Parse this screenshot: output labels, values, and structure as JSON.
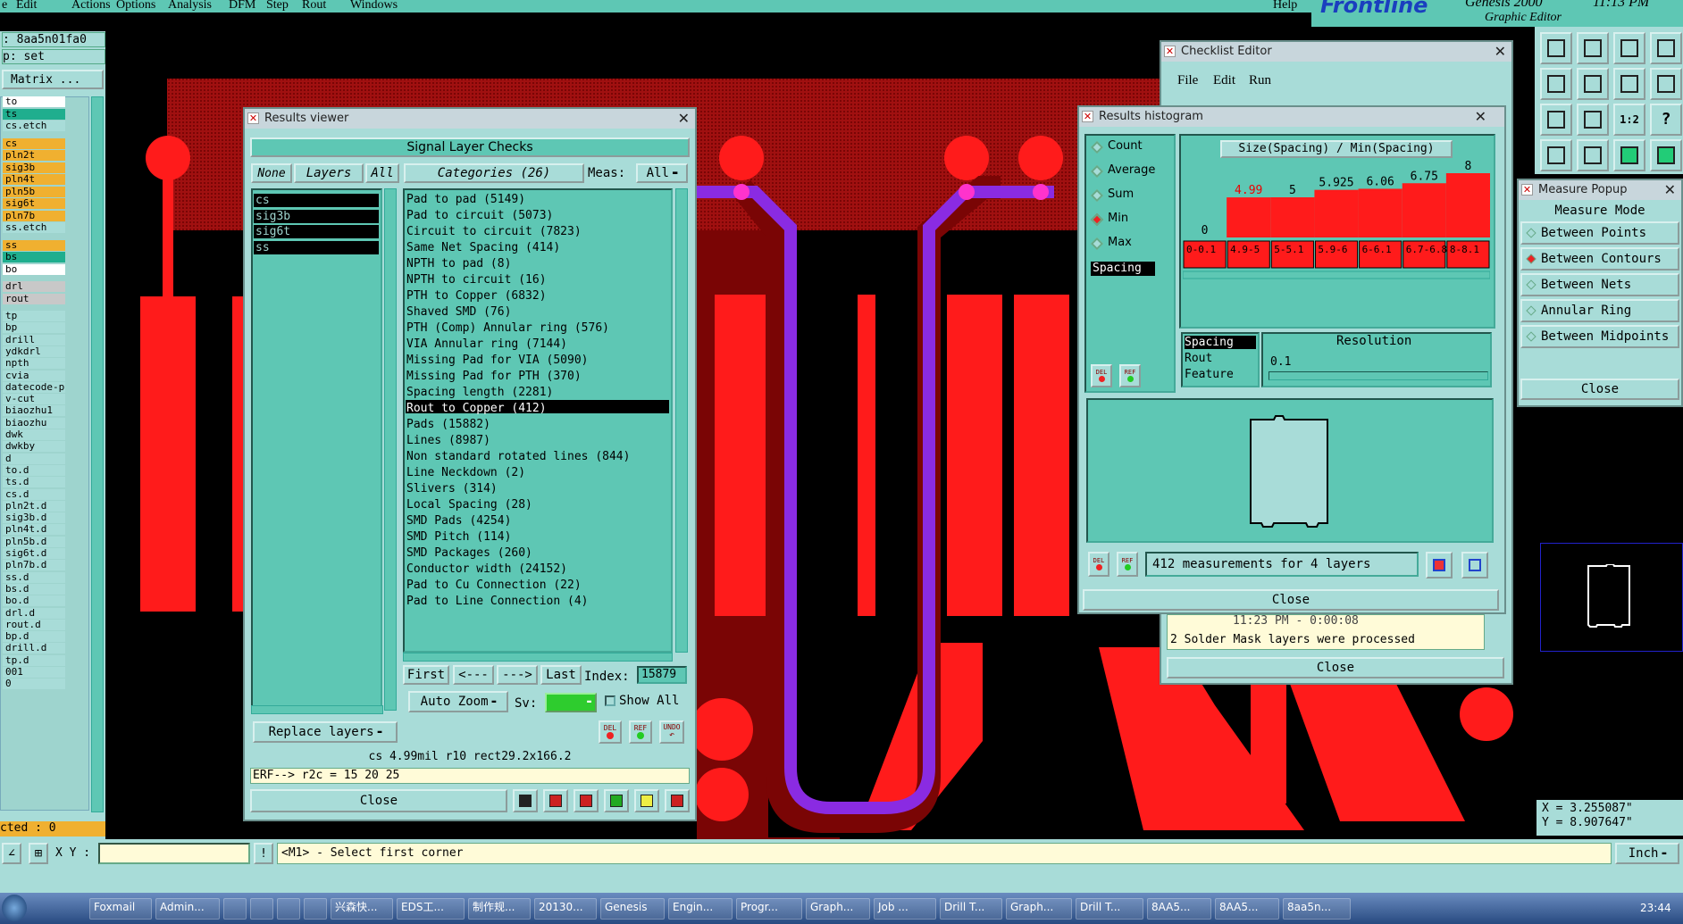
{
  "menubar": {
    "items": [
      "e",
      "Edit",
      "Actions",
      "Options",
      "Analysis",
      "DFM",
      "Step",
      "Rout",
      "Windows"
    ],
    "help": "Help",
    "brand": "Frontline",
    "product": "Genesis 2000",
    "subtitle": "Graphic Editor",
    "clock": "11:13 PM"
  },
  "left_panel": {
    "job": ": 8aa5n01fa0",
    "step": "p: set",
    "matrix_btn": "Matrix ...",
    "selected": "cted : 0"
  },
  "layers": [
    {
      "name": "to",
      "color": "#ffffff"
    },
    {
      "name": "ts",
      "color": "#1fae8e"
    },
    {
      "name": "cs.etch",
      "color": "#a8dcd8"
    },
    {
      "name": "cs",
      "color": "#f0b030"
    },
    {
      "name": "pln2t",
      "color": "#f0b030"
    },
    {
      "name": "sig3b",
      "color": "#f0b030"
    },
    {
      "name": "pln4t",
      "color": "#f0b030"
    },
    {
      "name": "pln5b",
      "color": "#f0b030"
    },
    {
      "name": "sig6t",
      "color": "#f0b030"
    },
    {
      "name": "pln7b",
      "color": "#f0b030"
    },
    {
      "name": "ss.etch",
      "color": "#a8dcd8"
    },
    {
      "name": "ss",
      "color": "#f0b030"
    },
    {
      "name": "bs",
      "color": "#1fae8e"
    },
    {
      "name": "bo",
      "color": "#ffffff"
    },
    {
      "name": "drl",
      "color": "#c8c8c8"
    },
    {
      "name": "rout",
      "color": "#c8c8c8"
    },
    {
      "name": "tp",
      "color": "#a8dcd8"
    },
    {
      "name": "bp",
      "color": "#a8dcd8"
    },
    {
      "name": "drill",
      "color": "#a8dcd8"
    },
    {
      "name": "ydkdrl",
      "color": "#a8dcd8"
    },
    {
      "name": "npth",
      "color": "#a8dcd8"
    },
    {
      "name": "cvia",
      "color": "#a8dcd8"
    },
    {
      "name": "datecode-pth",
      "color": "#a8dcd8"
    },
    {
      "name": "v-cut",
      "color": "#a8dcd8"
    },
    {
      "name": "biaozhu1",
      "color": "#a8dcd8"
    },
    {
      "name": "biaozhu",
      "color": "#a8dcd8"
    },
    {
      "name": "dwk",
      "color": "#a8dcd8"
    },
    {
      "name": "dwkby",
      "color": "#a8dcd8"
    },
    {
      "name": "d",
      "color": "#a8dcd8"
    },
    {
      "name": "to.d",
      "color": "#a8dcd8"
    },
    {
      "name": "ts.d",
      "color": "#a8dcd8"
    },
    {
      "name": "cs.d",
      "color": "#a8dcd8"
    },
    {
      "name": "pln2t.d",
      "color": "#a8dcd8"
    },
    {
      "name": "sig3b.d",
      "color": "#a8dcd8"
    },
    {
      "name": "pln4t.d",
      "color": "#a8dcd8"
    },
    {
      "name": "pln5b.d",
      "color": "#a8dcd8"
    },
    {
      "name": "sig6t.d",
      "color": "#a8dcd8"
    },
    {
      "name": "pln7b.d",
      "color": "#a8dcd8"
    },
    {
      "name": "ss.d",
      "color": "#a8dcd8"
    },
    {
      "name": "bs.d",
      "color": "#a8dcd8"
    },
    {
      "name": "bo.d",
      "color": "#a8dcd8"
    },
    {
      "name": "drl.d",
      "color": "#a8dcd8"
    },
    {
      "name": "rout.d",
      "color": "#a8dcd8"
    },
    {
      "name": "bp.d",
      "color": "#a8dcd8"
    },
    {
      "name": "drill.d",
      "color": "#a8dcd8"
    },
    {
      "name": "tp.d",
      "color": "#a8dcd8"
    },
    {
      "name": "001",
      "color": "#a8dcd8"
    },
    {
      "name": "0",
      "color": "#a8dcd8"
    }
  ],
  "results_viewer": {
    "title": "Results viewer",
    "header": "Signal Layer Checks",
    "none_btn": "None",
    "layers_btn": "Layers",
    "all_btn": "All",
    "categories_btn": "Categories (26)",
    "meas_label": "Meas:",
    "meas_value": "All",
    "layers": [
      "cs",
      "sig3b",
      "sig6t",
      "ss"
    ],
    "categories": [
      "Pad to pad (5149)",
      "Pad to circuit (5073)",
      "Circuit to circuit (7823)",
      "Same Net Spacing (414)",
      "NPTH to pad (8)",
      "NPTH to circuit (16)",
      "PTH to Copper (6832)",
      "Shaved SMD (76)",
      "PTH (Comp) Annular ring (576)",
      "VIA Annular ring (7144)",
      "Missing Pad for VIA (5090)",
      "Missing Pad for PTH (370)",
      "Spacing length (2281)",
      "Rout to Copper (412)",
      "Pads (15882)",
      "Lines (8987)",
      "Non standard rotated lines (844)",
      "Line Neckdown (2)",
      "Slivers (314)",
      "Local Spacing (28)",
      "SMD Pads (4254)",
      "SMD Pitch (114)",
      "SMD Packages (260)",
      "Conductor width (24152)",
      "Pad to Cu Connection (22)",
      "Pad to Line Connection (4)"
    ],
    "selected_index": 13,
    "first_btn": "First",
    "prev_btn": "<---",
    "next_btn": "--->",
    "last_btn": "Last",
    "index_label": "Index:",
    "index_value": "15879",
    "replace_btn": "Replace layers",
    "autozoom_btn": "Auto Zoom",
    "sv_label": "Sv:",
    "show_all": "Show All",
    "del": "DEL",
    "ref": "REF",
    "undo": "UNDO",
    "status": "cs  4.99mil  r10  rect29.2x166.2",
    "erf": "ERF--> r2c = 15 20 25",
    "close_btn": "Close"
  },
  "histogram": {
    "title": "Results histogram",
    "modes": [
      "Count",
      "Average",
      "Sum",
      "Min",
      "Max"
    ],
    "selected_mode": "Min",
    "chart_title": "Size(Spacing) / Min(Spacing)",
    "list_selected": "Spacing",
    "fields": [
      "Spacing",
      "Rout",
      "Feature"
    ],
    "resolution_label": "Resolution",
    "resolution_value": "0.1",
    "summary": "412 measurements for 4 layers",
    "close_btn": "Close",
    "del": "DEL",
    "ref": "REF"
  },
  "chart_data": {
    "type": "bar",
    "title": "Size(Spacing) / Min(Spacing)",
    "categories": [
      "0-0.1",
      "4.9-5",
      "5-5.1",
      "5.9-6",
      "6-6.1",
      "6.7-6.8",
      "8-8.1"
    ],
    "values": [
      0,
      4.99,
      5,
      5.925,
      6.06,
      6.75,
      8
    ],
    "value_labels": [
      "0",
      "4.99",
      "5",
      "5.925",
      "6.06",
      "6.75",
      "8"
    ],
    "highlight_color": "#ff1b1b"
  },
  "checklist": {
    "title": "Checklist Editor",
    "menu": [
      "File",
      "Edit",
      "Run"
    ],
    "time": "11:23 PM - 0:00:08",
    "message": "2 Solder Mask layers were processed",
    "close_btn": "Close"
  },
  "measure": {
    "title": "Measure Popup",
    "heading": "Measure Mode",
    "modes": [
      "Between Points",
      "Between Contours",
      "Between Nets",
      "Annular Ring",
      "Between Midpoints"
    ],
    "selected": "Between Contours",
    "close_btn": "Close"
  },
  "coords": {
    "x": "X = 3.255087\"",
    "y": "Y = 8.907647\""
  },
  "bottom": {
    "xy_label": "X Y :",
    "hint": "<M1> - Select first corner",
    "units": "Inch"
  },
  "taskbar": {
    "items": [
      "Foxmail",
      "Admin...",
      "",
      "",
      "",
      "",
      "兴森快...",
      "EDS工...",
      "制作规...",
      "20130...",
      "Genesis",
      "Engin...",
      "Progr...",
      "Graph...",
      "Job ...",
      "Drill T...",
      "Graph...",
      "Drill T...",
      "8AA5...",
      "8AA5...",
      "8aa5n..."
    ],
    "clock": "23:44"
  }
}
